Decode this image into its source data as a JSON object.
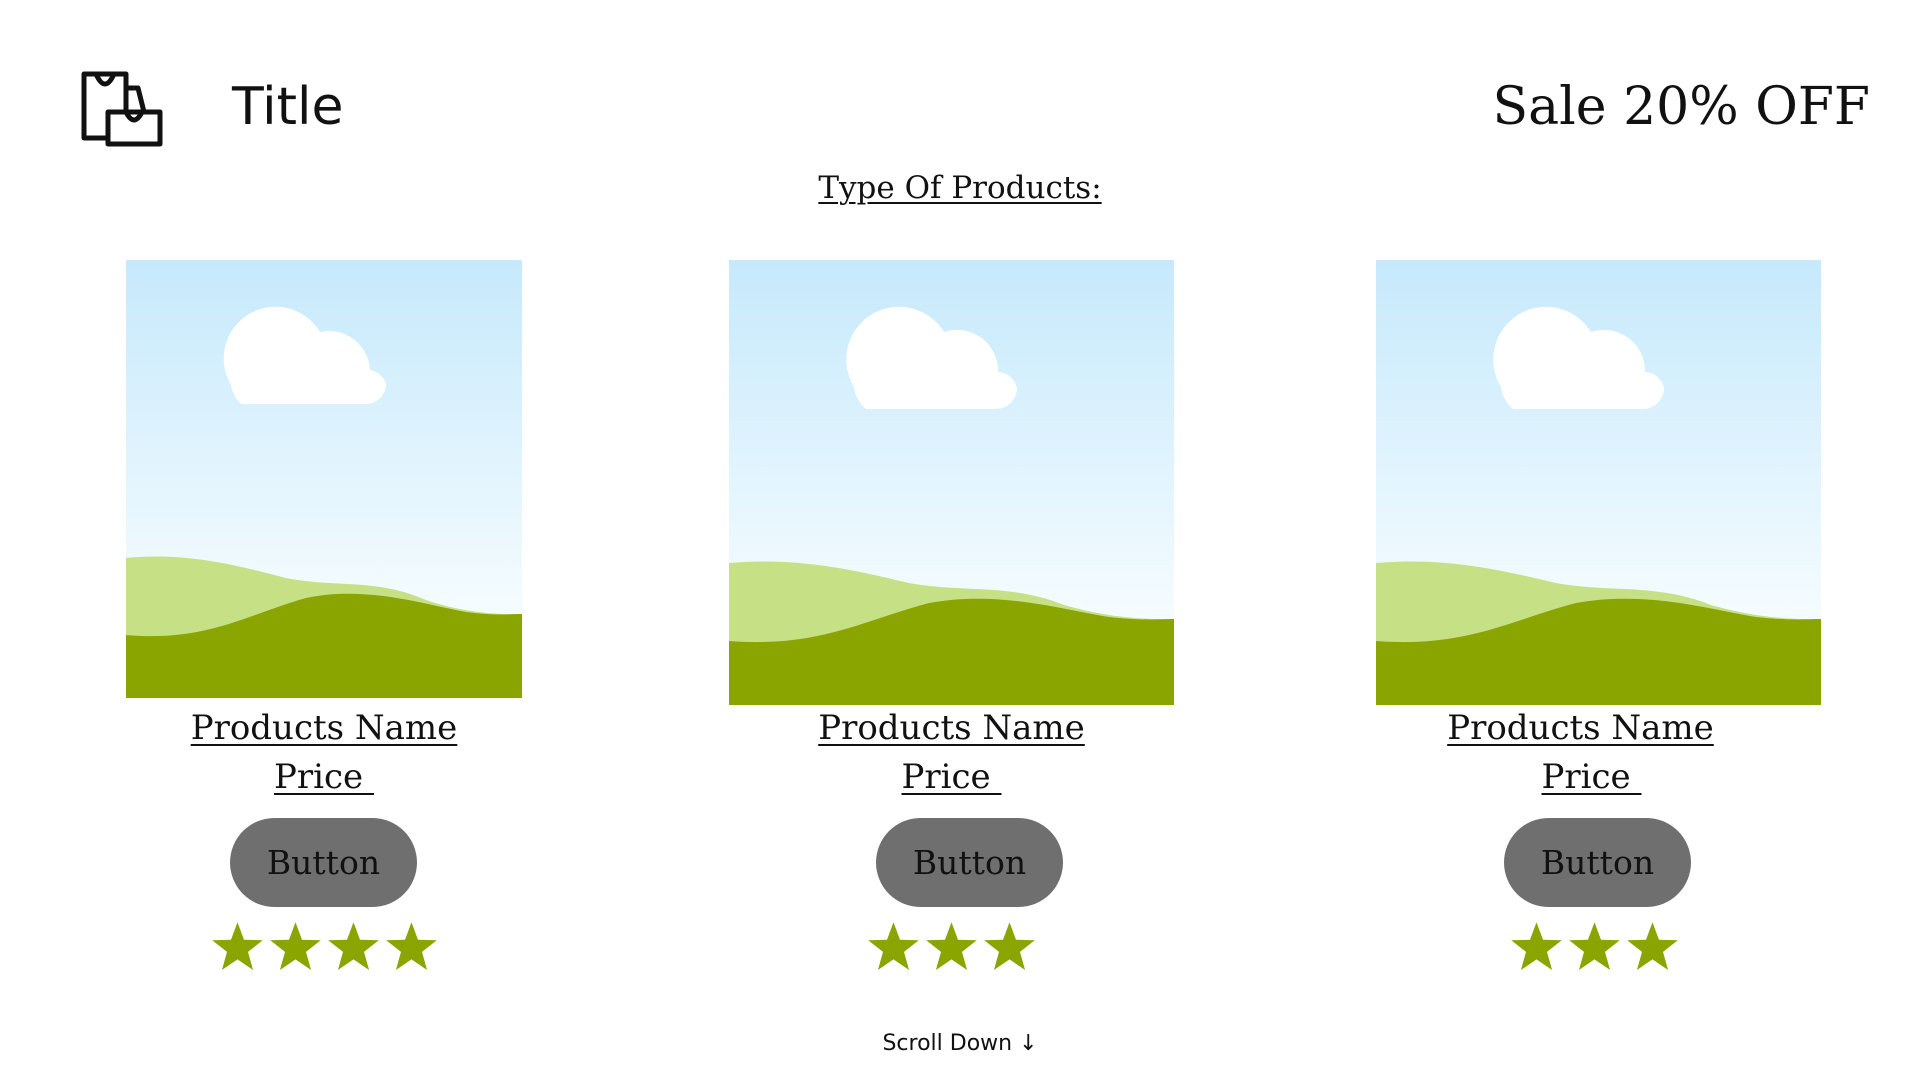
{
  "header": {
    "logo_icon": "shopping-bags-icon",
    "title": "Title",
    "sale": "Sale 20% OFF"
  },
  "section": {
    "heading": "Type Of Products:"
  },
  "products": [
    {
      "name": "Products Name",
      "price": "Price ",
      "button_label": "Button",
      "rating": 4,
      "image_icon": "landscape-image-placeholder"
    },
    {
      "name": "Products Name",
      "price": "Price ",
      "button_label": "Button",
      "rating": 3,
      "image_icon": "landscape-image-placeholder"
    },
    {
      "name": "Products Name",
      "price": "Price ",
      "button_label": "Button",
      "rating": 3,
      "image_icon": "landscape-image-placeholder"
    }
  ],
  "footer": {
    "scroll_hint": "Scroll Down ↓"
  },
  "colors": {
    "sky_top": "#c6e9fc",
    "sky_bottom": "#f5fcff",
    "hill_light": "#c5e085",
    "hill_dark": "#8aa400",
    "cloud": "#ffffff",
    "star": "#8aa400",
    "button_bg": "#6f6f6f",
    "text": "#111111"
  }
}
